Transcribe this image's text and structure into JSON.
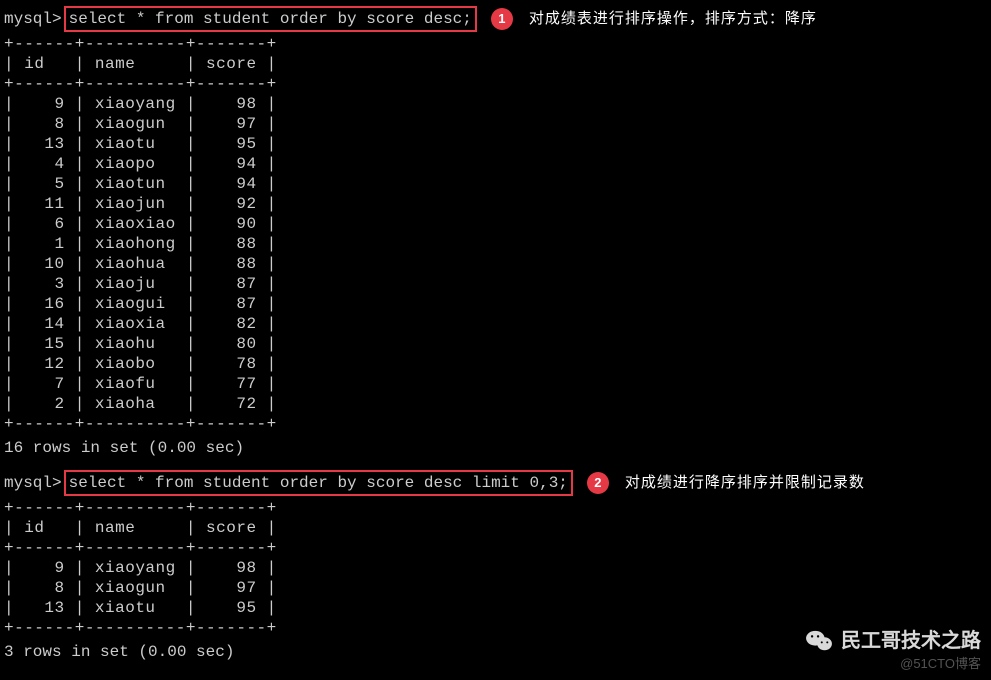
{
  "query1": {
    "prompt": "mysql>",
    "sql": "select * from student order by score desc;",
    "badge": "1",
    "annotation": "对成绩表进行排序操作，排序方式：降序",
    "divider_top": "+------+----------+-------+",
    "header_id": " id   ",
    "header_name": " name     ",
    "header_score": " score ",
    "divider_mid": "+------+----------+-------+",
    "rows": [
      {
        "id": "    9 ",
        "name": " xiaoyang ",
        "score": "    98 "
      },
      {
        "id": "    8 ",
        "name": " xiaogun  ",
        "score": "    97 "
      },
      {
        "id": "   13 ",
        "name": " xiaotu   ",
        "score": "    95 "
      },
      {
        "id": "    4 ",
        "name": " xiaopo   ",
        "score": "    94 "
      },
      {
        "id": "    5 ",
        "name": " xiaotun  ",
        "score": "    94 "
      },
      {
        "id": "   11 ",
        "name": " xiaojun  ",
        "score": "    92 "
      },
      {
        "id": "    6 ",
        "name": " xiaoxiao ",
        "score": "    90 "
      },
      {
        "id": "    1 ",
        "name": " xiaohong ",
        "score": "    88 "
      },
      {
        "id": "   10 ",
        "name": " xiaohua  ",
        "score": "    88 "
      },
      {
        "id": "    3 ",
        "name": " xiaoju   ",
        "score": "    87 "
      },
      {
        "id": "   16 ",
        "name": " xiaogui  ",
        "score": "    87 "
      },
      {
        "id": "   14 ",
        "name": " xiaoxia  ",
        "score": "    82 "
      },
      {
        "id": "   15 ",
        "name": " xiaohu   ",
        "score": "    80 "
      },
      {
        "id": "   12 ",
        "name": " xiaobo   ",
        "score": "    78 "
      },
      {
        "id": "    7 ",
        "name": " xiaofu   ",
        "score": "    77 "
      },
      {
        "id": "    2 ",
        "name": " xiaoha   ",
        "score": "    72 "
      }
    ],
    "divider_bot": "+------+----------+-------+",
    "footer": "16 rows in set (0.00 sec)"
  },
  "query2": {
    "prompt": "mysql>",
    "sql": "select * from student order by score desc limit 0,3;",
    "badge": "2",
    "annotation": "对成绩进行降序排序并限制记录数",
    "divider_top": "+------+----------+-------+",
    "header_id": " id   ",
    "header_name": " name     ",
    "header_score": " score ",
    "divider_mid": "+------+----------+-------+",
    "rows": [
      {
        "id": "    9 ",
        "name": " xiaoyang ",
        "score": "    98 "
      },
      {
        "id": "    8 ",
        "name": " xiaogun  ",
        "score": "    97 "
      },
      {
        "id": "   13 ",
        "name": " xiaotu   ",
        "score": "    95 "
      }
    ],
    "divider_bot": "+------+----------+-------+",
    "footer": "3 rows in set (0.00 sec)"
  },
  "watermark": {
    "main": "民工哥技术之路",
    "sub": "@51CTO博客"
  }
}
